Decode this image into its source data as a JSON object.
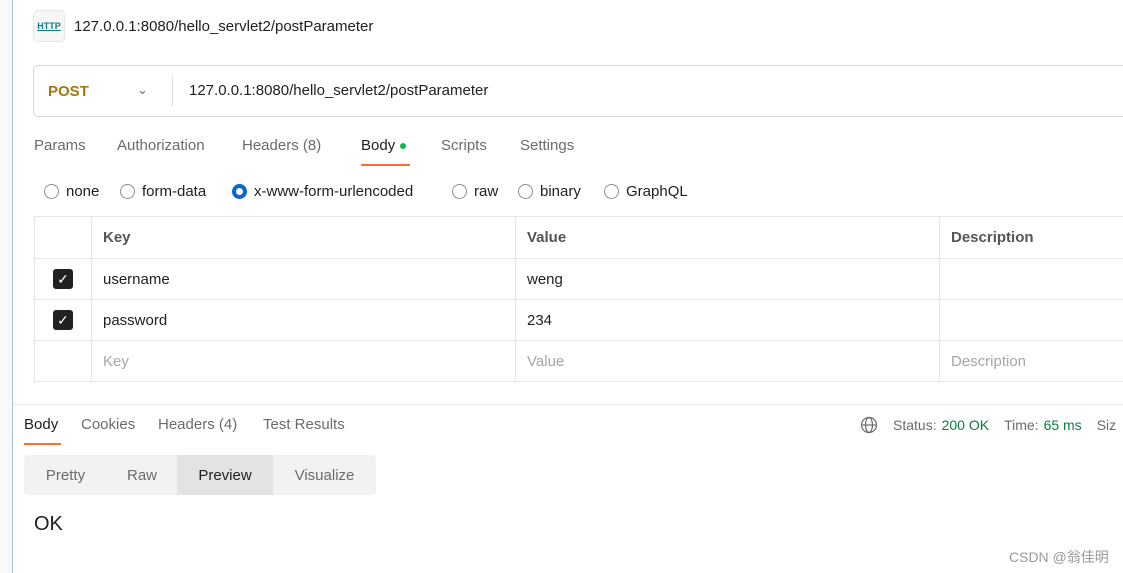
{
  "request": {
    "title": "127.0.0.1:8080/hello_servlet2/postParameter",
    "icon": "http-icon",
    "method": "POST",
    "url": "127.0.0.1:8080/hello_servlet2/postParameter"
  },
  "tabs": [
    "Params",
    "Authorization",
    "Headers (8)",
    "Body",
    "Scripts",
    "Settings"
  ],
  "active_tab": "Body",
  "body_types": [
    "none",
    "form-data",
    "x-www-form-urlencoded",
    "raw",
    "binary",
    "GraphQL"
  ],
  "selected_body_type": "x-www-form-urlencoded",
  "table": {
    "headers": [
      "Key",
      "Value",
      "Description"
    ],
    "rows": [
      {
        "checked": true,
        "key": "username",
        "value": "weng"
      },
      {
        "checked": true,
        "key": "password",
        "value": "234"
      }
    ],
    "placeholders": {
      "key": "Key",
      "value": "Value",
      "description": "Description"
    }
  },
  "response": {
    "tabs": [
      "Body",
      "Cookies",
      "Headers (4)",
      "Test Results"
    ],
    "active_tab": "Body",
    "status_label": "Status:",
    "status": "200 OK",
    "time_label": "Time:",
    "time": "65 ms",
    "size_label": "Siz",
    "views": [
      "Pretty",
      "Raw",
      "Preview",
      "Visualize"
    ],
    "active_view": "Preview",
    "content": "OK"
  },
  "watermark": "CSDN @翁佳明",
  "colors": {
    "accent": "#ff6c37",
    "method": "#a6780c",
    "status": "#0a7e3f",
    "radio": "#0a66d1"
  }
}
